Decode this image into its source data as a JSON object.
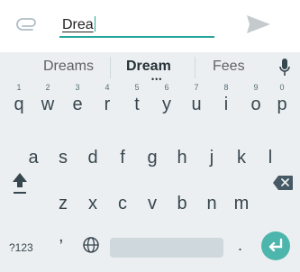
{
  "compose": {
    "text": "Drea",
    "icons": {
      "attach": "paperclip-icon",
      "send": "send-icon"
    }
  },
  "suggestions": [
    "Dreams",
    "Dream",
    "Fees"
  ],
  "number_hints": [
    "1",
    "2",
    "3",
    "4",
    "5",
    "6",
    "7",
    "8",
    "9",
    "0"
  ],
  "rows": {
    "r1": [
      "q",
      "w",
      "e",
      "r",
      "t",
      "y",
      "u",
      "i",
      "o",
      "p"
    ],
    "r2": [
      "a",
      "s",
      "d",
      "f",
      "g",
      "h",
      "j",
      "k",
      "l"
    ],
    "r3": [
      "z",
      "x",
      "c",
      "v",
      "b",
      "n",
      "m"
    ]
  },
  "bottom": {
    "symbols_label": "?123",
    "comma": ",",
    "period": "."
  },
  "colors": {
    "accent": "#26a69a",
    "enter": "#4db6ac",
    "keyboard_bg": "#eceff1"
  }
}
